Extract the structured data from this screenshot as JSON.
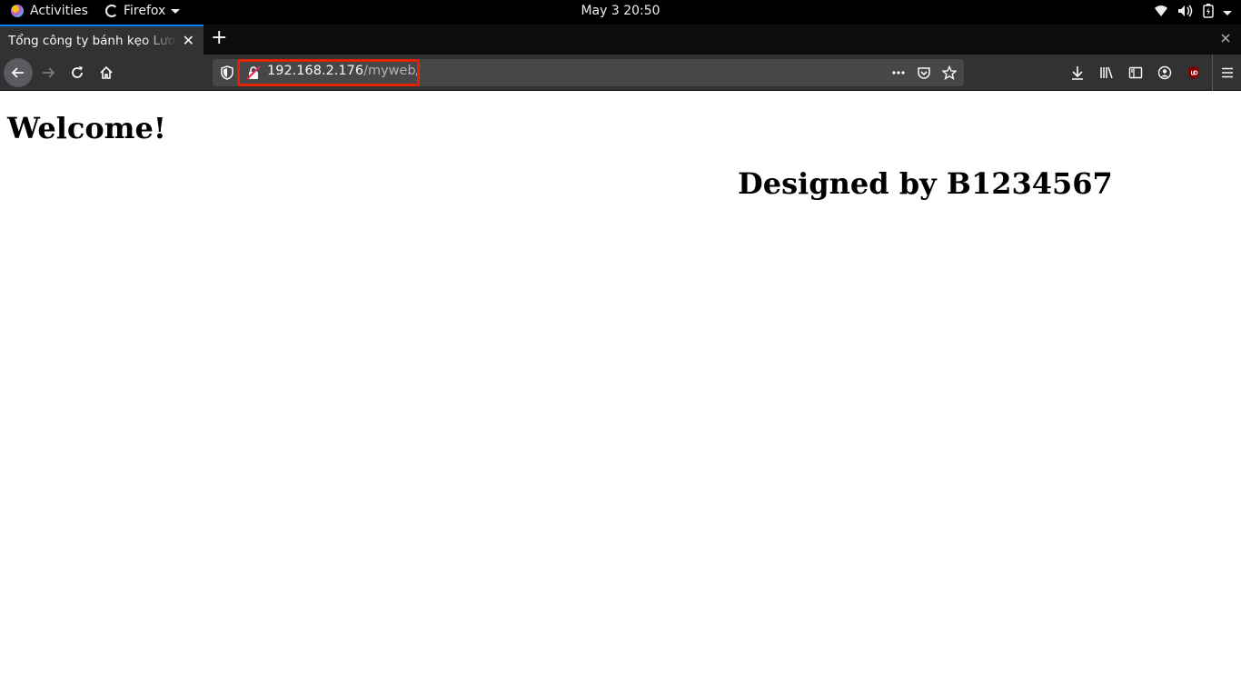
{
  "topbar": {
    "activities_label": "Activities",
    "app_label": "Firefox",
    "clock": "May 3  20:50",
    "icons": [
      "wifi-icon",
      "volume-icon",
      "battery-icon",
      "system-menu-caret-icon"
    ]
  },
  "browser": {
    "tab": {
      "title": "Tổng công ty bánh kẹo Lươn",
      "close_glyph": "✕"
    },
    "new_tab_glyph": "+",
    "url": {
      "host": "192.168.2.176",
      "path": "/myweb/"
    },
    "colors": {
      "tab_accent": "#0a84ff",
      "highlight_box": "#e32300",
      "toolbar_bg": "#323234"
    }
  },
  "page": {
    "heading": "Welcome!",
    "credit": "Designed by B1234567"
  }
}
